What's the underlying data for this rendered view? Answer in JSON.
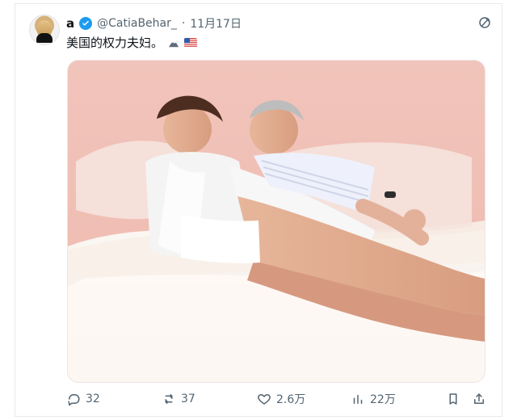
{
  "post": {
    "name": "a",
    "handle": "@CatiaBehar_",
    "separator": "·",
    "date": "11月17日",
    "text": "美国的权力夫妇。",
    "emoji": {
      "mountain": "mountain-emoji",
      "flag": "us-flag-emoji"
    }
  },
  "actions": {
    "replies": "32",
    "retweets": "37",
    "likes": "2.6万",
    "views": "22万"
  },
  "colors": {
    "blue": "#1d9bf0",
    "gray": "#536471"
  }
}
